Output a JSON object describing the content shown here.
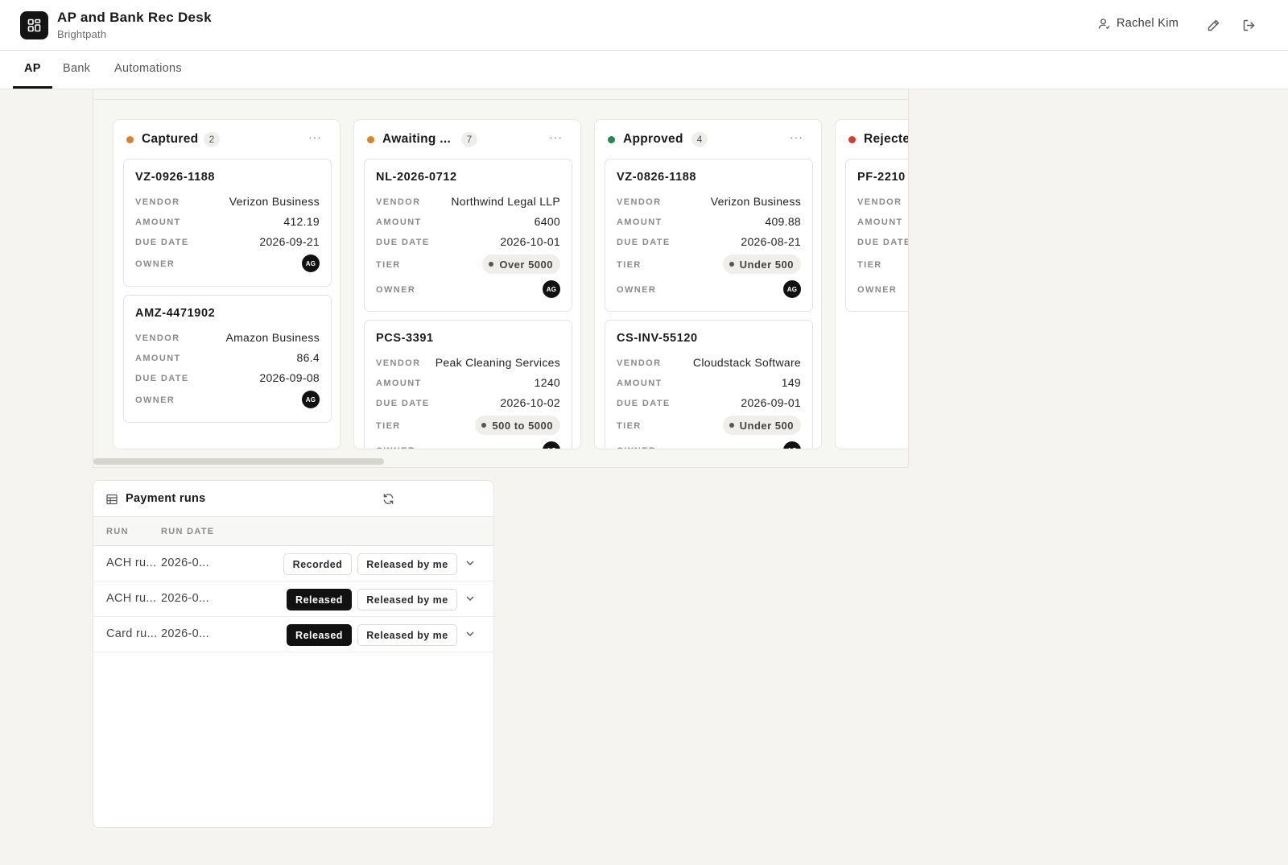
{
  "app": {
    "title": "AP and Bank Rec Desk",
    "subtitle": "Brightpath"
  },
  "header": {
    "user_name": "Rachel Kim"
  },
  "tabs": [
    {
      "label": "AP",
      "active": true
    },
    {
      "label": "Bank",
      "active": false
    },
    {
      "label": "Automations",
      "active": false
    }
  ],
  "board": {
    "labels": {
      "vendor": "VENDOR",
      "amount": "AMOUNT",
      "due_date": "DUE DATE",
      "tier": "TIER",
      "owner": "OWNER"
    },
    "more_label": "···",
    "columns": [
      {
        "title": "Captured",
        "count": "2",
        "color": "#d9822b",
        "cards": [
          {
            "id": "VZ-0926-1188",
            "vendor": "Verizon Business",
            "amount": "412.19",
            "due_date": "2026-09-21",
            "owner": "AG"
          },
          {
            "id": "AMZ-4471902",
            "vendor": "Amazon Business",
            "amount": "86.4",
            "due_date": "2026-09-08",
            "owner": "AG"
          }
        ]
      },
      {
        "title": "Awaiting ...",
        "count": "7",
        "color": "#d9822b",
        "cards": [
          {
            "id": "NL-2026-0712",
            "vendor": "Northwind Legal LLP",
            "amount": "6400",
            "due_date": "2026-10-01",
            "tier": "Over 5000",
            "owner": "AG"
          },
          {
            "id": "PCS-3391",
            "vendor": "Peak Cleaning Services",
            "amount": "1240",
            "due_date": "2026-10-02",
            "tier": "500 to 5000",
            "owner": "AG"
          }
        ]
      },
      {
        "title": "Approved",
        "count": "4",
        "color": "#1f8a4c",
        "cards": [
          {
            "id": "VZ-0826-1188",
            "vendor": "Verizon Business",
            "amount": "409.88",
            "due_date": "2026-08-21",
            "tier": "Under 500",
            "owner": "AG"
          },
          {
            "id": "CS-INV-55120",
            "vendor": "Cloudstack Software",
            "amount": "149",
            "due_date": "2026-09-01",
            "tier": "Under 500",
            "owner": "AG"
          }
        ]
      },
      {
        "title": "Rejecte",
        "color": "#d23b2f",
        "cards": [
          {
            "id": "PF-2210"
          }
        ]
      }
    ]
  },
  "payment_runs": {
    "title": "Payment runs",
    "columns": [
      "RUN",
      "RUN DATE"
    ],
    "rows": [
      {
        "run": "ACH ru...",
        "run_date": "2026-0...",
        "status": "Recorded",
        "status_style": "outline",
        "release": "Released by me"
      },
      {
        "run": "ACH ru...",
        "run_date": "2026-0...",
        "status": "Released",
        "status_style": "solid",
        "release": "Released by me"
      },
      {
        "run": "Card ru...",
        "run_date": "2026-0...",
        "status": "Released",
        "status_style": "solid",
        "release": "Released by me"
      }
    ]
  },
  "icons": {
    "app": "grid-icon",
    "user": "user-icon",
    "edit": "pencil-icon",
    "logout": "logout-icon",
    "table": "table-icon",
    "refresh": "refresh-icon",
    "expand": "chevron-down-icon"
  }
}
